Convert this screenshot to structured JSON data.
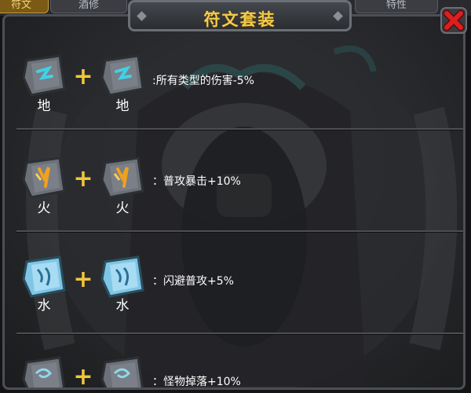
{
  "tabs": [
    {
      "label": "符文",
      "active": true
    },
    {
      "label": "酒修",
      "active": false
    },
    {
      "label": "特性",
      "active": false
    }
  ],
  "panel": {
    "title": "符文套装"
  },
  "close_icon": "close-x-icon",
  "sets": [
    {
      "element": "earth",
      "left_label": "地",
      "right_label": "地",
      "plus": "+",
      "effect": ":所有类型的伤害-5%",
      "glyph_color": "#3fd1e6"
    },
    {
      "element": "fire",
      "left_label": "火",
      "right_label": "火",
      "plus": "+",
      "effect": "：普攻暴击+10%",
      "glyph_color": "#f0a020"
    },
    {
      "element": "water",
      "left_label": "水",
      "right_label": "水",
      "plus": "+",
      "effect": "：闪避普攻+5%",
      "glyph_color": "#6fd8f5"
    },
    {
      "element": "wind",
      "left_label": "",
      "right_label": "",
      "plus": "+",
      "effect": "：怪物掉落+10%",
      "glyph_color": "#8fd8ea"
    }
  ],
  "colors": {
    "title": "#f2cc4a",
    "plus": "#f2c63a",
    "close": "#d92020",
    "active_tab": "#7a5a14"
  }
}
